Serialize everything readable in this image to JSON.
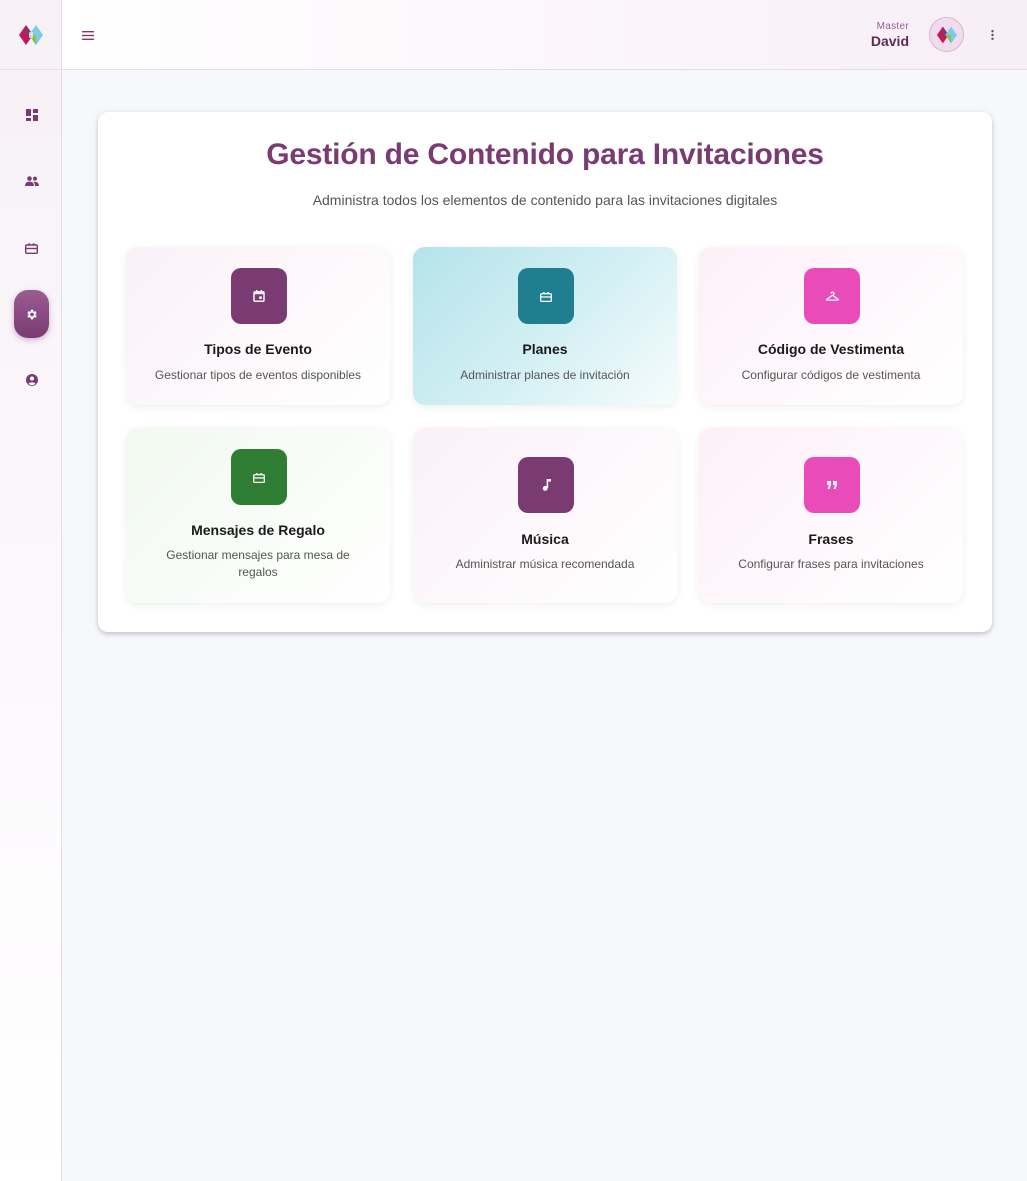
{
  "header": {
    "user_role": "Master",
    "user_name": "David"
  },
  "page": {
    "title": "Gestión de Contenido para Invitaciones",
    "subtitle": "Administra todos los elementos de contenido para las invitaciones digitales"
  },
  "colors": {
    "primary": "#7a3b72",
    "teal": "#1f7f91",
    "pink": "#e94cb9",
    "green": "#2e7d32"
  },
  "sidebar": {
    "items": [
      {
        "icon": "dashboard-icon",
        "active": false
      },
      {
        "icon": "people-icon",
        "active": false
      },
      {
        "icon": "gift-card-icon",
        "active": false
      },
      {
        "icon": "gear-icon",
        "active": true
      },
      {
        "icon": "account-circle-icon",
        "active": false
      }
    ]
  },
  "cards": [
    {
      "title": "Tipos de Evento",
      "description": "Gestionar tipos de eventos disponibles",
      "icon": "calendar-icon"
    },
    {
      "title": "Planes",
      "description": "Administrar planes de invitación",
      "icon": "card-icon"
    },
    {
      "title": "Código de Vestimenta",
      "description": "Configurar códigos de vestimenta",
      "icon": "hanger-icon"
    },
    {
      "title": "Mensajes de Regalo",
      "description": "Gestionar mensajes para mesa de regalos",
      "icon": "gift-icon"
    },
    {
      "title": "Música",
      "description": "Administrar música recomendada",
      "icon": "music-note-icon"
    },
    {
      "title": "Frases",
      "description": "Configurar frases para invitaciones",
      "icon": "quote-icon"
    }
  ]
}
